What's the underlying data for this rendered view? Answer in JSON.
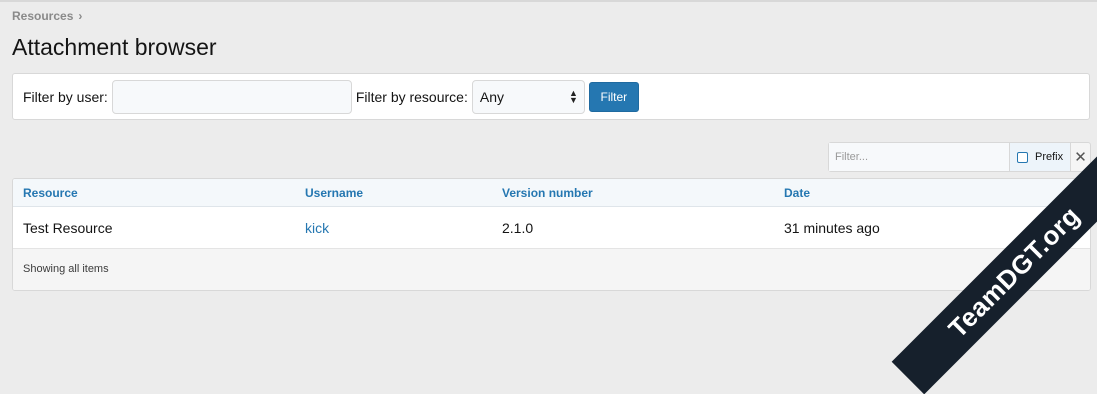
{
  "breadcrumb": {
    "label": "Resources"
  },
  "page_title": "Attachment browser",
  "filter_form": {
    "user_label": "Filter by user:",
    "user_value": "",
    "resource_label": "Filter by resource:",
    "resource_selected": "Any",
    "submit_label": "Filter"
  },
  "quick_filter": {
    "placeholder": "Filter...",
    "prefix_label": "Prefix",
    "clear_icon": "close-icon"
  },
  "table": {
    "columns": [
      "Resource",
      "Username",
      "Version number",
      "Date"
    ],
    "rows": [
      {
        "resource": "Test Resource",
        "username": "kick",
        "version": "2.1.0",
        "date": "31 minutes ago"
      }
    ],
    "footer": "Showing all items"
  },
  "watermark": "TeamDGT.org",
  "colors": {
    "accent": "#2577b1",
    "background": "#ececec",
    "watermark": "#16202c"
  }
}
